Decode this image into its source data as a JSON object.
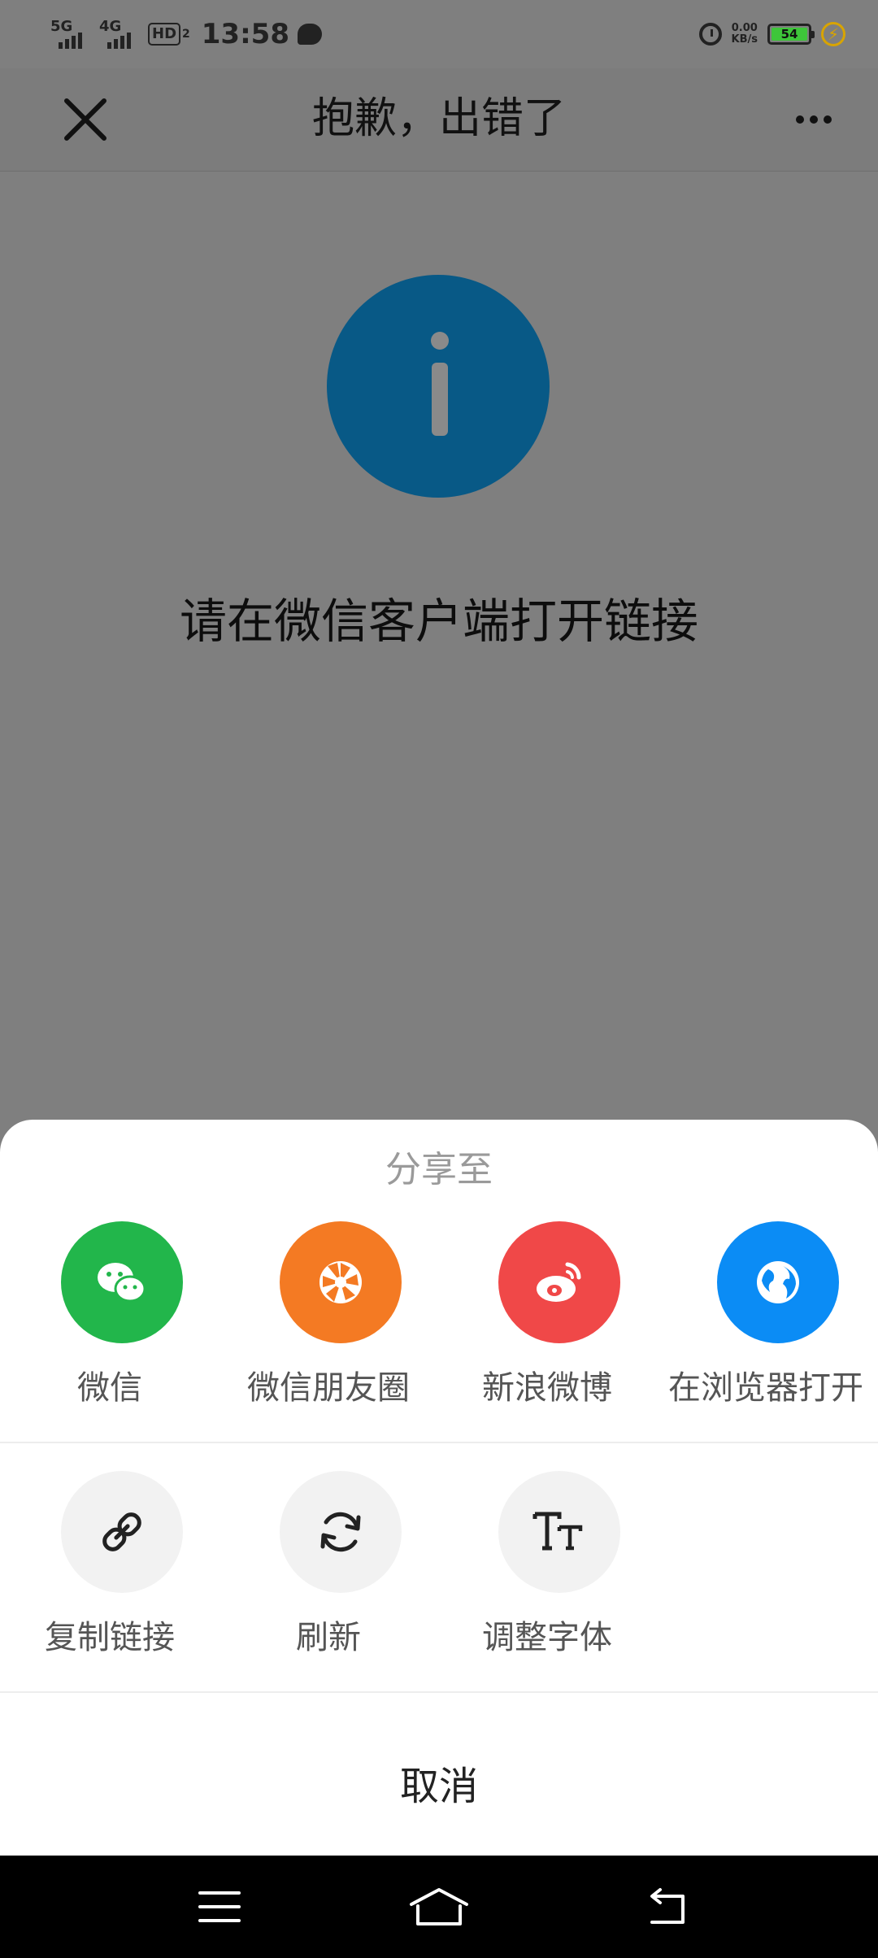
{
  "status_bar": {
    "signal1_label": "5G",
    "signal2_label": "4G",
    "hd_label": "HD",
    "hd_sub": "2",
    "time": "13:58",
    "net_speed_value": "0.00",
    "net_speed_unit": "KB/s",
    "battery_level": "54",
    "battery_color": "#3ec63a"
  },
  "title_bar": {
    "title": "抱歉，出错了",
    "close_icon": "close-icon",
    "more_icon": "more-icon"
  },
  "content": {
    "icon": "info-icon",
    "icon_color": "#085986",
    "message": "请在微信客户端打开链接"
  },
  "share_sheet": {
    "title": "分享至",
    "share_targets": [
      {
        "label": "微信",
        "icon": "wechat-icon",
        "color": "#22b64b"
      },
      {
        "label": "微信朋友圈",
        "icon": "moments-icon",
        "color": "#f47a23"
      },
      {
        "label": "新浪微博",
        "icon": "weibo-icon",
        "color": "#f04848"
      },
      {
        "label": "在浏览器打开",
        "icon": "globe-icon",
        "color": "#0b8cf5"
      }
    ],
    "actions": [
      {
        "label": "复制链接",
        "icon": "link-icon"
      },
      {
        "label": "刷新",
        "icon": "refresh-icon"
      },
      {
        "label": "调整字体",
        "icon": "font-size-icon"
      }
    ],
    "cancel_label": "取消"
  },
  "nav_bar": {
    "menu_icon": "menu-icon",
    "home_icon": "home-icon",
    "back_icon": "back-icon"
  }
}
